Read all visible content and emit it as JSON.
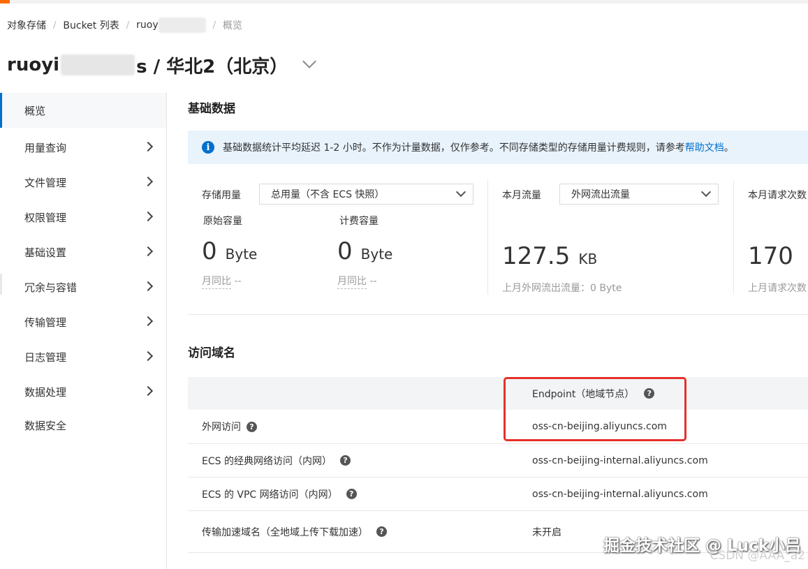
{
  "breadcrumb": {
    "items": [
      "对象存储",
      "Bucket 列表",
      "ruoy",
      "概览"
    ]
  },
  "header": {
    "title_prefix": "ruoyi",
    "title_suffix": "s / 华北2（北京）"
  },
  "sidebar": {
    "items": [
      {
        "label": "概览",
        "active": true
      },
      {
        "label": "用量查询"
      },
      {
        "label": "文件管理"
      },
      {
        "label": "权限管理"
      },
      {
        "label": "基础设置"
      },
      {
        "label": "冗余与容错"
      },
      {
        "label": "传输管理"
      },
      {
        "label": "日志管理"
      },
      {
        "label": "数据处理"
      },
      {
        "label": "数据安全"
      }
    ]
  },
  "basic": {
    "title": "基础数据",
    "notice_text": "基础数据统计平均延迟 1-2 小时。不作为计量数据，仅作参考。不同存储类型的存储用量计费规则，请参考",
    "notice_link": "帮助文档",
    "notice_end": " 。",
    "storage": {
      "label": "存储用量",
      "select_value": "总用量（不含 ECS 快照）",
      "raw_label": "原始容量",
      "raw_value": "0",
      "raw_unit": "Byte",
      "raw_mom_label": "月同比",
      "raw_mom_value": "--",
      "billed_label": "计费容量",
      "billed_value": "0",
      "billed_unit": "Byte",
      "billed_mom_label": "月同比",
      "billed_mom_value": "--"
    },
    "traffic": {
      "label": "本月流量",
      "select_value": "外网流出流量",
      "value": "127.5",
      "unit": "KB",
      "last_month": "上月外网流出流量：0 Byte"
    },
    "requests": {
      "label": "本月请求次数",
      "value": "170",
      "last_month": "上月请求次数"
    }
  },
  "domains": {
    "title": "访问域名",
    "header_endpoint": "Endpoint（地域节点）",
    "rows": [
      {
        "label": "外网访问",
        "value": "oss-cn-beijing.aliyuncs.com"
      },
      {
        "label": "ECS 的经典网络访问（内网）",
        "value": "oss-cn-beijing-internal.aliyuncs.com"
      },
      {
        "label": "ECS 的 VPC 网络访问（内网）",
        "value": "oss-cn-beijing-internal.aliyuncs.com"
      },
      {
        "label": "传输加速域名（全地域上传下载加速）",
        "value": "未开启"
      }
    ]
  },
  "watermark": {
    "main": "掘金技术社区 @ Luck小吕",
    "sub": "CSDN @AAA_a2"
  },
  "colors": {
    "accent": "#ff6a00",
    "link": "#0070cc",
    "notice_bg": "#e8f3fc",
    "highlight": "#e5302a"
  }
}
